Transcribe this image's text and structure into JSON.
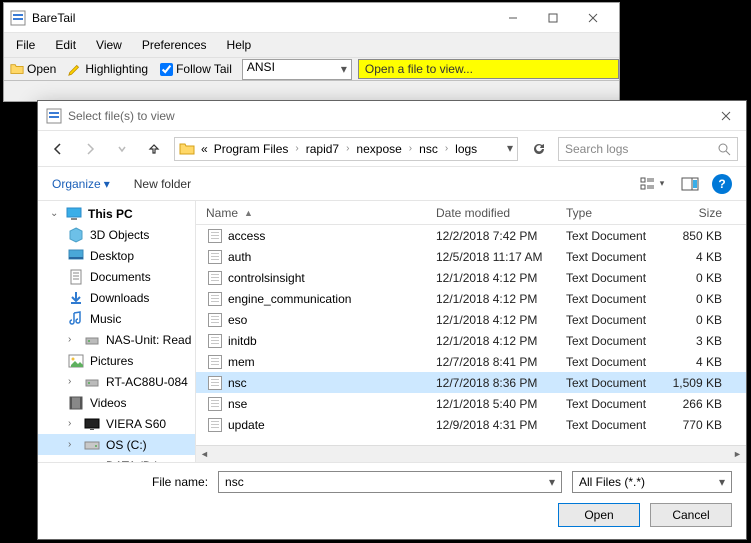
{
  "app": {
    "title": "BareTail",
    "menu": [
      "File",
      "Edit",
      "View",
      "Preferences",
      "Help"
    ],
    "toolbar": {
      "open": "Open",
      "highlighting": "Highlighting",
      "follow_tail": "Follow Tail",
      "encoding": "ANSI",
      "banner": "Open a file to view..."
    }
  },
  "dialog": {
    "title": "Select file(s) to view",
    "breadcrumb_prefix": "«",
    "breadcrumb": [
      "Program Files",
      "rapid7",
      "nexpose",
      "nsc",
      "logs"
    ],
    "search_placeholder": "Search logs",
    "organize": "Organize",
    "new_folder": "New folder",
    "headers": {
      "name": "Name",
      "date": "Date modified",
      "type": "Type",
      "size": "Size"
    },
    "tree": [
      {
        "label": "This PC",
        "icon": "monitor",
        "bold": true,
        "expanded": true
      },
      {
        "label": "3D Objects",
        "icon": "cube",
        "indent": true
      },
      {
        "label": "Desktop",
        "icon": "desktop",
        "indent": true
      },
      {
        "label": "Documents",
        "icon": "doc",
        "indent": true
      },
      {
        "label": "Downloads",
        "icon": "down",
        "indent": true
      },
      {
        "label": "Music",
        "icon": "note",
        "indent": true
      },
      {
        "label": "NAS-Unit: Read",
        "icon": "net",
        "indent": true,
        "expander": true
      },
      {
        "label": "Pictures",
        "icon": "pic",
        "indent": true
      },
      {
        "label": "RT-AC88U-084",
        "icon": "net",
        "indent": true,
        "expander": true
      },
      {
        "label": "Videos",
        "icon": "film",
        "indent": true
      },
      {
        "label": "VIERA S60",
        "icon": "tv",
        "indent": true,
        "expander": true
      },
      {
        "label": "OS (C:)",
        "icon": "drive",
        "indent": true,
        "expander": true,
        "selected": true
      },
      {
        "label": "DATA (D:)",
        "icon": "drive",
        "indent": true,
        "expander": true
      }
    ],
    "files": [
      {
        "name": "access",
        "date": "12/2/2018 7:42 PM",
        "type": "Text Document",
        "size": "850 KB"
      },
      {
        "name": "auth",
        "date": "12/5/2018 11:17 AM",
        "type": "Text Document",
        "size": "4 KB"
      },
      {
        "name": "controlsinsight",
        "date": "12/1/2018 4:12 PM",
        "type": "Text Document",
        "size": "0 KB"
      },
      {
        "name": "engine_communication",
        "date": "12/1/2018 4:12 PM",
        "type": "Text Document",
        "size": "0 KB"
      },
      {
        "name": "eso",
        "date": "12/1/2018 4:12 PM",
        "type": "Text Document",
        "size": "0 KB"
      },
      {
        "name": "initdb",
        "date": "12/1/2018 4:12 PM",
        "type": "Text Document",
        "size": "3 KB"
      },
      {
        "name": "mem",
        "date": "12/7/2018 8:41 PM",
        "type": "Text Document",
        "size": "4 KB"
      },
      {
        "name": "nsc",
        "date": "12/7/2018 8:36 PM",
        "type": "Text Document",
        "size": "1,509 KB",
        "selected": true
      },
      {
        "name": "nse",
        "date": "12/1/2018 5:40 PM",
        "type": "Text Document",
        "size": "266 KB"
      },
      {
        "name": "update",
        "date": "12/9/2018 4:31 PM",
        "type": "Text Document",
        "size": "770 KB"
      }
    ],
    "file_name_label": "File name:",
    "file_name_value": "nsc",
    "filter": "All Files (*.*)",
    "open_btn": "Open",
    "cancel_btn": "Cancel",
    "help": "?"
  }
}
